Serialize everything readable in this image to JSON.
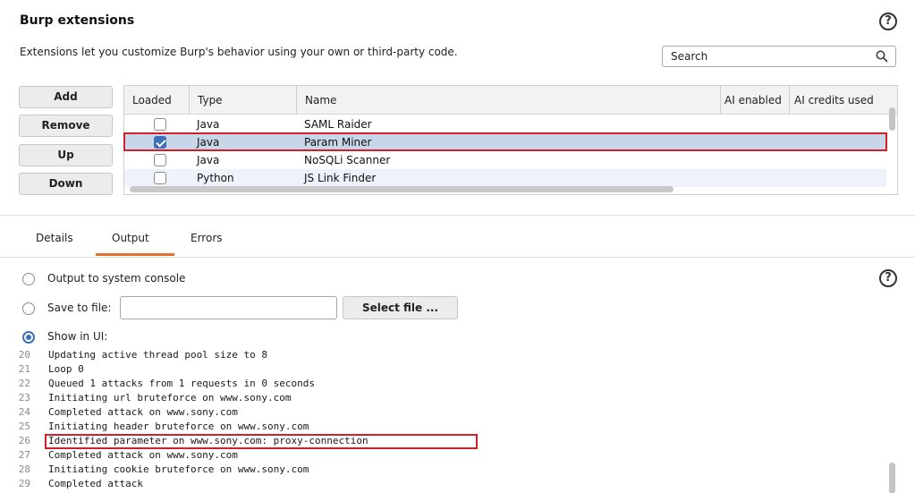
{
  "header": {
    "title": "Burp extensions",
    "subtitle": "Extensions let you customize Burp's behavior using your own or third-party code.",
    "help_icon": "?",
    "search_placeholder": "Search"
  },
  "buttons": {
    "add": "Add",
    "remove": "Remove",
    "up": "Up",
    "down": "Down"
  },
  "table": {
    "columns": [
      "Loaded",
      "Type",
      "Name",
      "AI enabled",
      "AI credits used"
    ],
    "rows": [
      {
        "loaded": false,
        "type": "Java",
        "name": "SAML Raider"
      },
      {
        "loaded": true,
        "type": "Java",
        "name": "Param Miner"
      },
      {
        "loaded": false,
        "type": "Java",
        "name": "NoSQLi Scanner"
      },
      {
        "loaded": false,
        "type": "Python",
        "name": "JS Link Finder"
      }
    ],
    "selected_row": 1
  },
  "tabs": {
    "items": [
      "Details",
      "Output",
      "Errors"
    ],
    "active": "Output"
  },
  "output": {
    "option_console": "Output to system console",
    "option_file": "Save to file:",
    "option_ui": "Show in UI:",
    "file_value": "",
    "select_file_label": "Select file ...",
    "selected_option": "ui",
    "help_icon": "?"
  },
  "console": {
    "lines": [
      {
        "n": "20",
        "text": "Updating active thread pool size to 8"
      },
      {
        "n": "21",
        "text": "Loop 0"
      },
      {
        "n": "22",
        "text": "Queued 1 attacks from 1 requests in 0 seconds"
      },
      {
        "n": "23",
        "text": "Initiating url bruteforce on www.sony.com"
      },
      {
        "n": "24",
        "text": "Completed attack on www.sony.com"
      },
      {
        "n": "25",
        "text": "Initiating header bruteforce on www.sony.com"
      },
      {
        "n": "26",
        "text": "Identified parameter on www.sony.com: proxy-connection"
      },
      {
        "n": "27",
        "text": "Completed attack on www.sony.com"
      },
      {
        "n": "28",
        "text": "Initiating cookie bruteforce on www.sony.com"
      },
      {
        "n": "29",
        "text": "Completed attack"
      }
    ],
    "highlighted_line": "26"
  },
  "colors": {
    "accent": "#e8702a",
    "selection": "#c8d6ea",
    "highlight_border": "#d21f2a",
    "checkbox": "#3f6fb8"
  },
  "icons": {
    "help": "help-circle-icon",
    "search": "search-icon",
    "checkbox": "checkbox-icon",
    "radio": "radio-icon"
  }
}
